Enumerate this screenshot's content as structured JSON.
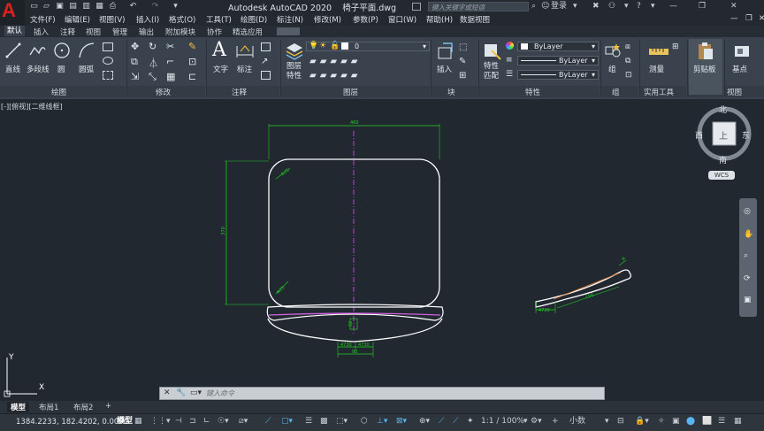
{
  "app": {
    "title": "Autodesk AutoCAD 2020",
    "filename": "椅子平面.dwg",
    "logo_letter": "A",
    "search_placeholder": "键入关键字或短语",
    "login_label": "登录"
  },
  "menu": [
    "文件(F)",
    "编辑(E)",
    "视图(V)",
    "插入(I)",
    "格式(O)",
    "工具(T)",
    "绘图(D)",
    "标注(N)",
    "修改(M)",
    "参数(P)",
    "窗口(W)",
    "帮助(H)",
    "数据视图"
  ],
  "ribbon_tabs": [
    "默认",
    "插入",
    "注释",
    "视图",
    "管理",
    "输出",
    "附加模块",
    "协作",
    "精选应用"
  ],
  "active_tab": "默认",
  "ribbon": {
    "draw": {
      "title": "绘图",
      "line": "直线",
      "polyline": "多段线",
      "circle": "圆",
      "arc": "圆弧"
    },
    "modify": {
      "title": "修改"
    },
    "annotation": {
      "title": "注释",
      "text": "文字",
      "dimension": "标注"
    },
    "layers": {
      "title": "图层",
      "layer_props": "图层\n特性",
      "current_layer": "0"
    },
    "block": {
      "title": "块",
      "insert": "插入"
    },
    "properties": {
      "title": "特性",
      "match": "特性\n匹配",
      "color": "ByLayer",
      "linetype": "ByLayer",
      "lineweight": "ByLayer"
    },
    "groups": {
      "title": "组",
      "group": "组"
    },
    "utilities": {
      "title": "实用工具",
      "measure": "测量"
    },
    "clipboard": {
      "title": "剪贴板",
      "paste": "剪贴板"
    },
    "view": {
      "title": "视图",
      "base": "基点"
    }
  },
  "viewport": {
    "label": "[-][俯视][二维线框]",
    "viewcube": {
      "north": "北",
      "south": "南",
      "east": "东",
      "west": "西",
      "top": "上",
      "wcs": "WCS"
    },
    "ucs": {
      "x": "X",
      "y": "Y"
    },
    "dims": {
      "width_top": "460",
      "height_left": "370",
      "radius_top": "R75",
      "radius_bottom": "R75",
      "center_small": "32",
      "bottom_left": "4730",
      "bottom_right": "4730",
      "bottom_total": "90",
      "side_small": "4730",
      "side_r": "R",
      "side_angle": "156"
    }
  },
  "command": {
    "placeholder": "键入命令"
  },
  "layout_tabs": [
    "模型",
    "布局1",
    "布局2"
  ],
  "active_layout": "模型",
  "status": {
    "coords": "1384.2233, 182.4202, 0.0000",
    "model": "模型",
    "scale": "1:1 / 100%",
    "units": "小数"
  }
}
